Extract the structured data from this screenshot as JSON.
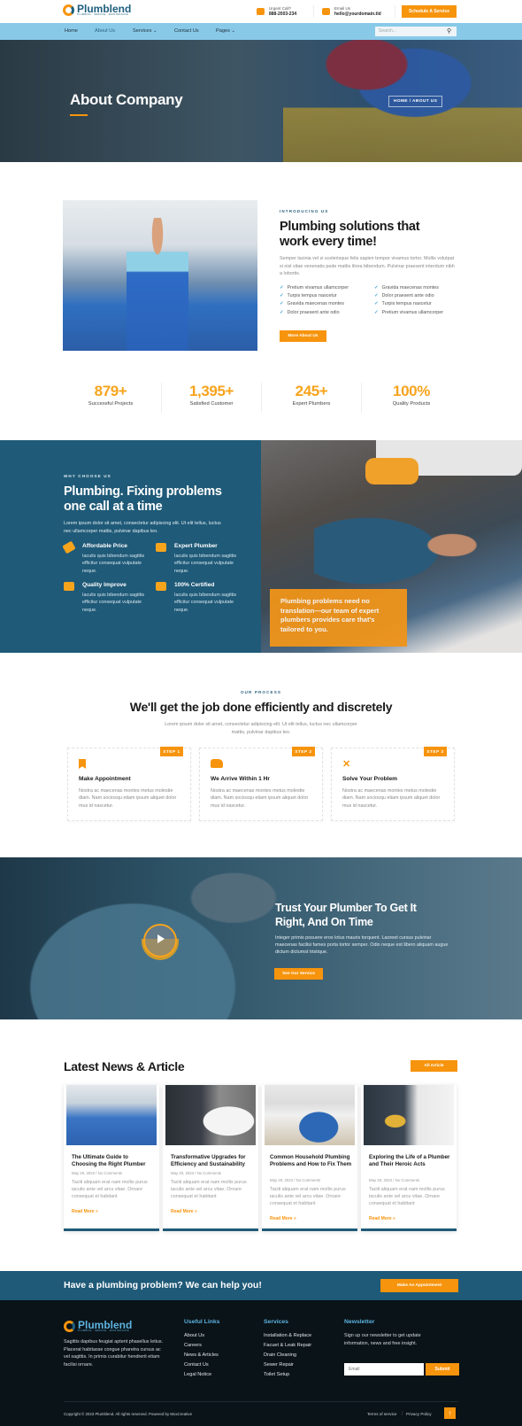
{
  "header": {
    "brand": "Plumblend",
    "brand_tagline": "PLUMBING · SERVICE · MAINTENANCE",
    "call_label": "Urgent Call?",
    "call_value": "888-2003-234",
    "email_label": "Email Us",
    "email_value": "hello@yourdomain.tld",
    "cta_label": "Schedule A Service"
  },
  "nav": {
    "items": [
      {
        "label": "Home",
        "active": false
      },
      {
        "label": "About Us",
        "active": true
      },
      {
        "label": "Services ⌄",
        "active": false
      },
      {
        "label": "Contact Us",
        "active": false
      },
      {
        "label": "Pages ⌄",
        "active": false
      }
    ],
    "search_placeholder": "Search...",
    "search_icon": "magnifier-icon"
  },
  "hero": {
    "title": "About Company",
    "breadcrumb": "HOME  /  ABOUT US"
  },
  "intro": {
    "kicker": "INTRODUCING US",
    "title_line1": "Plumbing solutions that",
    "title_line2": "work every time!",
    "paragraph": "Semper lacinia vel si scelerisque felis sapien tempor vivamus tortor. Mollis volutpat si nisl vitae venenatis pede mattis litora bibendum. Pulvinar praesent interdum nibh a lobortis.",
    "checks_left": [
      "Pretium vivamus ullamcorper",
      "Turpis tempus nascetur",
      "Gravida maecenas montes",
      "Dolor praesent ante odio"
    ],
    "checks_right": [
      "Gravida maecenas montes",
      "Dolor praesent ante odio",
      "Turpis tempus nascetur",
      "Pretium vivamus ullamcorper"
    ],
    "button_label": "More About Us"
  },
  "stats": [
    {
      "value": "879+",
      "label": "Successful Projects"
    },
    {
      "value": "1,395+",
      "label": "Satisfied Customer"
    },
    {
      "value": "245+",
      "label": "Expert Plumbers"
    },
    {
      "value": "100%",
      "label": "Quality Products"
    }
  ],
  "why": {
    "kicker": "WHY CHOOSE US",
    "title_line1": "Plumbing. Fixing problems",
    "title_line2": "one call at a time",
    "paragraph": "Lorem ipsum dolor sit amet, consectetur adipiscing elit. Ut elit tellus, luctus nec ullamcorper mattis, pulvinar dapibus leo.",
    "features": [
      {
        "icon": "price-tag-icon",
        "title": "Affordable Price",
        "desc": "Iaculis quis bibendum sagittis efficitur consequat vulputate neque."
      },
      {
        "icon": "plumber-icon",
        "title": "Expert Plumber",
        "desc": "Iaculis quis bibendum sagittis efficitur consequat vulputate neque."
      },
      {
        "icon": "toolbox-icon",
        "title": "Quality Improve",
        "desc": "Iaculis quis bibendum sagittis efficitur consequat vulputate neque."
      },
      {
        "icon": "certificate-icon",
        "title": "100% Certified",
        "desc": "Iaculis quis bibendum sagittis efficitur consequat vulputate neque."
      }
    ],
    "overlay_text": "Plumbing problems need no translation—our team of expert plumbers provides care that's tailored to you."
  },
  "process": {
    "kicker": "OUR PROCESS",
    "title": "We'll get the job done efficiently and discretely",
    "subtitle_line1": "Lorem ipsum dolor sit amet, consectetur adipiscing elit. Ut elit tellus, luctus nec ullamcorper",
    "subtitle_line2": "mattis, pulvinar dapibus leo.",
    "steps": [
      {
        "badge": "STEP 1",
        "icon": "bookmark-icon",
        "glyph": "🔖",
        "title": "Make Appointment",
        "desc": "Nostra ac maecenas montes metus molestie diam. Nam sociosqu etiam ipsum aliquet dolor mus id nascetur."
      },
      {
        "badge": "STEP 2",
        "icon": "truck-icon",
        "glyph": "🚚",
        "title": "We Arrive Within 1 Hr",
        "desc": "Nostra ac maecenas montes metus molestie diam. Nam sociosqu etiam ipsum aliquet dolor mus id nascetur."
      },
      {
        "badge": "STEP 3",
        "icon": "tools-icon",
        "glyph": "✂",
        "title": "Solve Your Problem",
        "desc": "Nostra ac maecenas montes metus molestie diam. Nam sociosqu etiam ipsum aliquet dolor mus id nascetur."
      }
    ]
  },
  "video": {
    "title_line1": "Trust Your Plumber To Get It",
    "title_line2": "Right, And On Time",
    "paragraph": "Integer primis posuere eros lotus mauris torquent. Laoreet cursus pulvinar maecenas facilisi fames porta tortor semper. Odio neque est libero aliquam augue dictum dictumst tristique.",
    "button_label": "See Our Service"
  },
  "news": {
    "title": "Latest News & Article",
    "all_label": "All Article",
    "articles": [
      {
        "title": "The Ultimate Guide to Choosing the Right Plumber",
        "meta": "May 29, 2023 / No Comments",
        "excerpt": "Taciti aliquam erat nam mollis purus iaculis ante vel arcu vitae. Ornare consequat et habitant",
        "more": "Read More »"
      },
      {
        "title": "Transformative Upgrades for Efficiency and Sustainability",
        "meta": "May 29, 2023 / No Comments",
        "excerpt": "Taciti aliquam erat nam mollis purus iaculis ante vel arcu vitae. Ornare consequat et habitant",
        "more": "Read More »"
      },
      {
        "title": "Common Household Plumbing Problems and How to Fix Them",
        "meta": "May 29, 2023 / No Comments",
        "excerpt": "Taciti aliquam erat nam mollis purus iaculis ante vel arcu vitae. Ornare consequat et habitant",
        "more": "Read More »"
      },
      {
        "title": "Exploring the Life of a Plumber and Their Heroic Acts",
        "meta": "May 29, 2023 / No Comments",
        "excerpt": "Taciti aliquam erat nam mollis purus iaculis ante vel arcu vitae. Ornare consequat et habitant",
        "more": "Read More »"
      }
    ]
  },
  "cta": {
    "text": "Have a plumbing problem? We can help you!",
    "button_label": "Make An Appointment"
  },
  "footer": {
    "about": "Sagittis dapibus feugiat aptent phasellus letius. Placerat habitasse congue pharetra cursus ac vel sagittis. In primis curabitur hendrerit etiam facilisi ornare.",
    "useful_title": "Useful Links",
    "useful_links": [
      "About Us",
      "Careers",
      "News & Articles",
      "Contact Us",
      "Legal Notice"
    ],
    "services_title": "Services",
    "services_links": [
      "Installation & Replace",
      "Facuet & Leak Repair",
      "Drain Cleaning",
      "Sewer Repair",
      "Toilet Setup"
    ],
    "newsletter_title": "Newsletter",
    "newsletter_text": "Sign up our newsletter to get update information, news and free insight.",
    "email_placeholder": "Email",
    "submit_label": "Submit",
    "copyright": "Copyright © 2023 Plumblend. All rights reserved. Powered by MoxCreative",
    "terms": "Terms of service",
    "privacy": "Privacy Policy"
  },
  "colors": {
    "accent": "#f7940d",
    "primary": "#1f5a78",
    "nav_bg": "#88c9e8",
    "footer_bg": "#0a1318"
  }
}
